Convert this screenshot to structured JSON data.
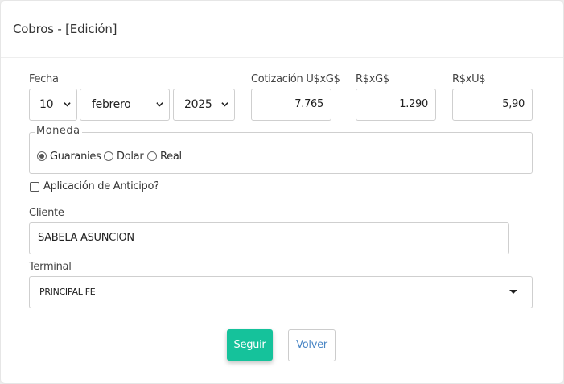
{
  "header": {
    "title": "Cobros - [Edición]"
  },
  "fecha": {
    "label": "Fecha",
    "day": "10",
    "month": "febrero",
    "year": "2025"
  },
  "rates": {
    "usd_gs": {
      "label": "Cotización U$xG$",
      "value": "7.765"
    },
    "brl_gs": {
      "label": "R$xG$",
      "value": "1.290"
    },
    "brl_usd": {
      "label": "R$xU$",
      "value": "5,90"
    }
  },
  "moneda": {
    "legend": "Moneda",
    "options": [
      "Guaranies",
      "Dolar",
      "Real"
    ],
    "selected": "Guaranies"
  },
  "anticipo": {
    "label": "Aplicación de Anticipo?",
    "checked": false
  },
  "cliente": {
    "label": "Cliente",
    "value": "SABELA ASUNCION"
  },
  "terminal": {
    "label": "Terminal",
    "value": "PRINCIPAL FE"
  },
  "actions": {
    "primary": "Seguir",
    "secondary": "Volver"
  }
}
